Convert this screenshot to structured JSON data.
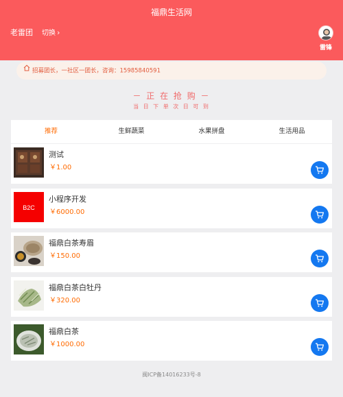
{
  "header": {
    "title": "福鼎生活网",
    "leader_name": "老雷团",
    "switch_label": "切换",
    "user_name": "雷锋"
  },
  "notice": {
    "text": "招募团长，一社区一团长，咨询：15985840591"
  },
  "flash_sale": {
    "title": "－ 正 在 抢 购 －",
    "subtitle": "当 日 下 单  次 日 可 到"
  },
  "tabs": [
    {
      "label": "推荐",
      "active": true
    },
    {
      "label": "生鲜蔬菜",
      "active": false
    },
    {
      "label": "水果拼盘",
      "active": false
    },
    {
      "label": "生活用品",
      "active": false
    }
  ],
  "products": [
    {
      "name": "测试",
      "price": "￥1.00",
      "thumb": "cabinet-photo"
    },
    {
      "name": "小程序开发",
      "price": "￥6000.00",
      "thumb": "b2c-logo",
      "thumb_text": "B2C"
    },
    {
      "name": "福鼎白茶寿眉",
      "price": "￥150.00",
      "thumb": "tea-set-photo"
    },
    {
      "name": "福鼎白茶白牡丹",
      "price": "￥320.00",
      "thumb": "tea-leaves-photo"
    },
    {
      "name": "福鼎白茶",
      "price": "￥1000.00",
      "thumb": "tea-bowl-photo"
    }
  ],
  "footer": {
    "icp": "闽ICP备14016233号-8"
  },
  "colors": {
    "header_bg": "#fb5a5c",
    "accent": "#ff6a00",
    "cart_button": "#1478f0"
  }
}
